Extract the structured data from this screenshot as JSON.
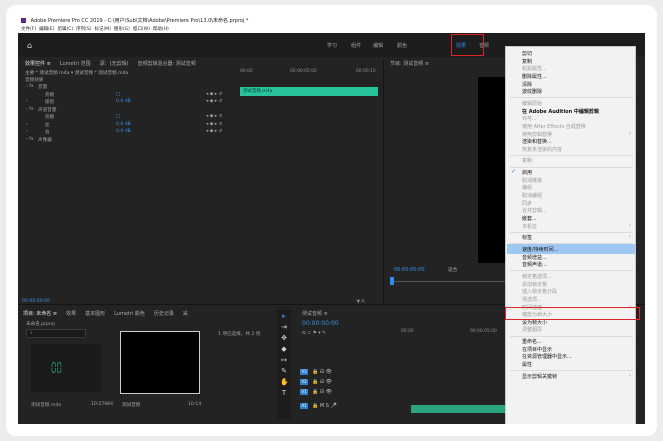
{
  "window_title": "Adobe Premiere Pro CC 2019 - C:\\用户\\Sub\\文档\\Adobe\\Premiere Pro\\13.0\\未命名.prproj *",
  "menubar": [
    "文件(F)",
    "编辑(E)",
    "剪辑(C)",
    "序列(S)",
    "标记(M)",
    "图形(G)",
    "窗口(W)",
    "帮助(H)"
  ],
  "workspaces": [
    "学习",
    "组件",
    "编辑",
    "颜色",
    "效果",
    "音频"
  ],
  "workspace_active": "效果",
  "source_tabs": [
    "效果控件 ≡",
    "Lumetri 范围",
    "源：(无剪辑)",
    "音频剪辑混合器: 测试音频"
  ],
  "effect_controls": {
    "master_line": "主要 * 测试音频.m4a  ▾  测试音频 * 测试音频.m4a",
    "audio_label": "音频效果",
    "rows": [
      {
        "indent": "› fx",
        "label": "音量",
        "value": ""
      },
      {
        "indent": "",
        "label": "旁路",
        "value": "□"
      },
      {
        "indent": "›",
        "label": "级别",
        "value": "0.0 dB"
      },
      {
        "indent": "› fx",
        "label": "声道音量",
        "value": ""
      },
      {
        "indent": "",
        "label": "旁路",
        "value": "□"
      },
      {
        "indent": "›",
        "label": "左",
        "value": "0.0 dB"
      },
      {
        "indent": "›",
        "label": "右",
        "value": "0.0 dB"
      },
      {
        "indent": "› fx",
        "label": "声像器",
        "value": ""
      }
    ],
    "ruler_start": "00:00",
    "ruler_mid": "00:00:05:00",
    "ruler_end": "00:00:10",
    "clip_label": "测试音频.m4a",
    "timecode": "00:00:00:00"
  },
  "program": {
    "tab": "节目: 测试音频 ≡",
    "timecode": "00:00:00:00",
    "fit": "适合"
  },
  "project": {
    "tabs": [
      "项目: 未命名 ≡",
      "效果",
      "基本图形",
      "Lumetri 颜色",
      "历史记录",
      "采"
    ],
    "file": "未命名.prproj",
    "count": "1 项已选择，共 2 项",
    "items": [
      {
        "name": "测试音频.m4a",
        "duration": "10:27984"
      },
      {
        "name": "测试音频",
        "duration": "10:14"
      }
    ]
  },
  "timeline": {
    "tab": "测试音频 ≡",
    "timecode": "00:00:00:00",
    "ruler": [
      "00:00",
      "00:00:05:00"
    ],
    "video_tracks": [
      "V3",
      "V2",
      "V1"
    ],
    "audio_tracks": [
      "A1"
    ]
  },
  "context_menu": {
    "items": [
      {
        "label": "剪切",
        "disabled": false
      },
      {
        "label": "复制",
        "disabled": false
      },
      {
        "label": "粘贴属性...",
        "disabled": true
      },
      {
        "label": "删除属性...",
        "disabled": false
      },
      {
        "label": "清除",
        "disabled": false
      },
      {
        "label": "波纹删除",
        "disabled": false
      },
      {
        "sep": true
      },
      {
        "label": "编辑原始",
        "disabled": true
      },
      {
        "label": "在 Adobe Audition 中编辑剪辑",
        "disabled": false,
        "bold": true
      },
      {
        "label": "许可...",
        "disabled": true
      },
      {
        "label": "使用 After Effects 合成替换",
        "disabled": true
      },
      {
        "label": "使用剪辑替换",
        "disabled": true,
        "arrow": true
      },
      {
        "label": "渲染和替换...",
        "disabled": false
      },
      {
        "label": "恢复未渲染的内容",
        "disabled": true
      },
      {
        "sep": true
      },
      {
        "label": "复制",
        "disabled": true
      },
      {
        "sep": true
      },
      {
        "label": "启用",
        "disabled": false,
        "checked": true
      },
      {
        "label": "取消链接",
        "disabled": true
      },
      {
        "label": "编组",
        "disabled": true
      },
      {
        "label": "取消编组",
        "disabled": true
      },
      {
        "label": "同步",
        "disabled": true
      },
      {
        "label": "合并剪辑...",
        "disabled": true
      },
      {
        "label": "嵌套...",
        "disabled": false
      },
      {
        "label": "多机位",
        "disabled": true,
        "arrow": true
      },
      {
        "sep": true
      },
      {
        "label": "标签",
        "disabled": false,
        "arrow": true
      },
      {
        "sep": true
      },
      {
        "label": "速度/持续时间...",
        "disabled": false,
        "highlighted": true
      },
      {
        "label": "音频增益...",
        "disabled": false
      },
      {
        "label": "音频声道...",
        "disabled": false
      },
      {
        "sep": true
      },
      {
        "label": "帧定格选项...",
        "disabled": true
      },
      {
        "label": "添加帧定格",
        "disabled": true
      },
      {
        "label": "插入帧定格分段",
        "disabled": true
      },
      {
        "label": "场选项...",
        "disabled": true
      },
      {
        "label": "时间插值",
        "disabled": true,
        "arrow": true
      },
      {
        "label": "缩放为帧大小",
        "disabled": true
      },
      {
        "label": "设为帧大小",
        "disabled": false
      },
      {
        "label": "调整图层",
        "disabled": true
      },
      {
        "sep": true
      },
      {
        "label": "重命名...",
        "disabled": false
      },
      {
        "label": "在项目中显示",
        "disabled": false
      },
      {
        "label": "在资源管理器中显示...",
        "disabled": false
      },
      {
        "label": "属性",
        "disabled": false
      },
      {
        "sep": true
      },
      {
        "label": "显示剪辑关键帧",
        "disabled": false,
        "arrow": true
      }
    ]
  },
  "colors": {
    "accent_blue": "#2d8ceb",
    "highlight_box": "#e0242b",
    "clip_green": "#27c49c",
    "menu_highlight": "#9ec7f2"
  }
}
